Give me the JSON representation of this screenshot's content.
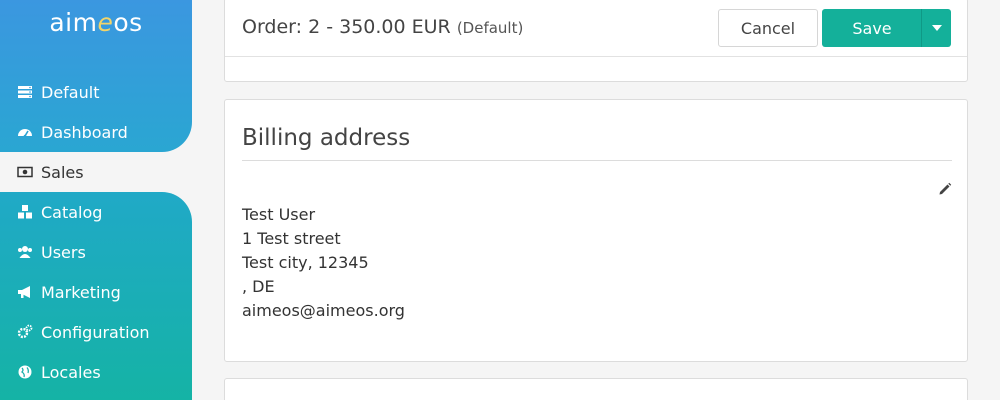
{
  "app": {
    "logo_prefix": "aim",
    "logo_accent": "e",
    "logo_suffix": "os"
  },
  "sidebar": {
    "items": [
      {
        "label": "Default",
        "icon": "server-icon"
      },
      {
        "label": "Dashboard",
        "icon": "dashboard-icon"
      },
      {
        "label": "Sales",
        "icon": "money-icon",
        "active": true
      },
      {
        "label": "Catalog",
        "icon": "cubes-icon"
      },
      {
        "label": "Users",
        "icon": "users-icon"
      },
      {
        "label": "Marketing",
        "icon": "bullhorn-icon"
      },
      {
        "label": "Configuration",
        "icon": "cogs-icon"
      },
      {
        "label": "Locales",
        "icon": "globe-icon"
      }
    ]
  },
  "header": {
    "title": "Order: 2 - 350.00 EUR",
    "subtitle": "(Default)",
    "cancel_label": "Cancel",
    "save_label": "Save"
  },
  "billing": {
    "title": "Billing address",
    "lines": [
      "Test User",
      "1 Test street",
      "Test city, 12345",
      ", DE",
      "aimeos@aimeos.org"
    ]
  },
  "colors": {
    "sidebar_top": "#3b97e0",
    "sidebar_bottom": "#15b3a5",
    "primary": "#14b09a",
    "logo_accent": "#f2d46a"
  }
}
